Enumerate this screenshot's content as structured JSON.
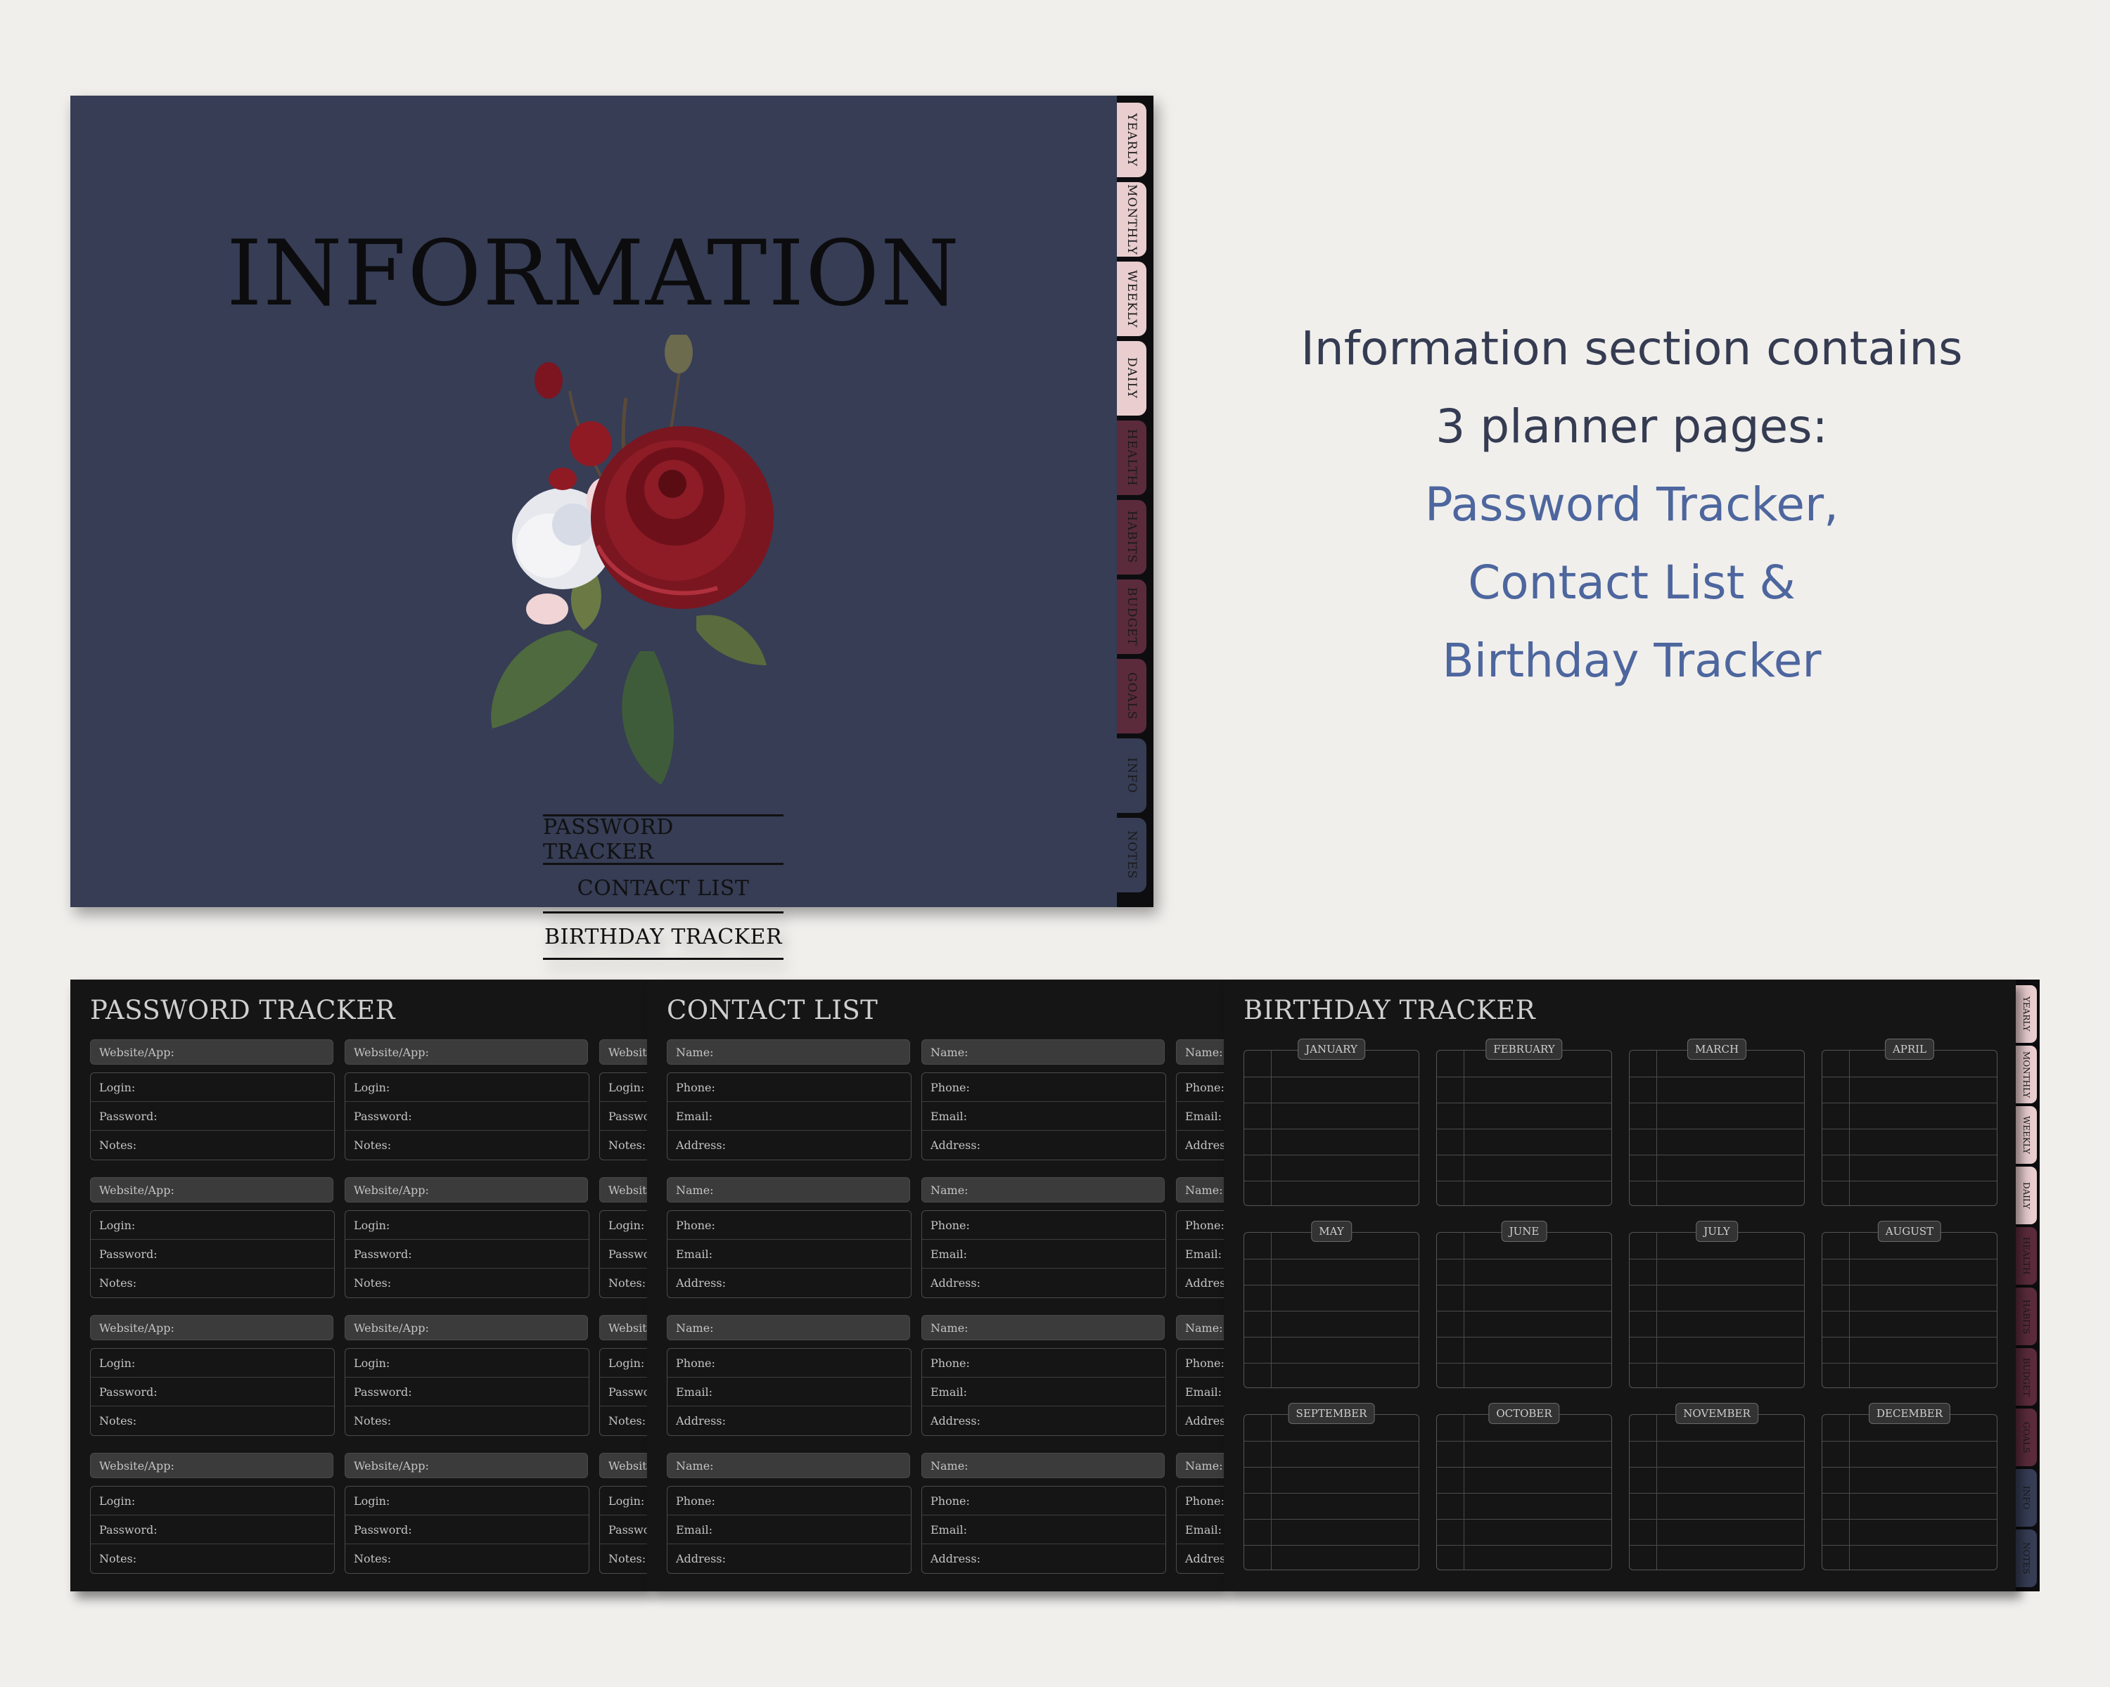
{
  "cover": {
    "title": "INFORMATION",
    "links": [
      "PASSWORD TRACKER",
      "CONTACT LIST",
      "BIRTHDAY TRACKER"
    ],
    "tabs": [
      {
        "label": "YEARLY",
        "color": "#e9cdcf"
      },
      {
        "label": "MONTHLY",
        "color": "#e9cdcf"
      },
      {
        "label": "WEEKLY",
        "color": "#e9cdcf"
      },
      {
        "label": "DAILY",
        "color": "#e9cdcf"
      },
      {
        "label": "HEALTH",
        "color": "#5b2b3b"
      },
      {
        "label": "HABITS",
        "color": "#5b2b3b"
      },
      {
        "label": "BUDGET",
        "color": "#5b2b3b"
      },
      {
        "label": "GOALS",
        "color": "#5b2b3b"
      },
      {
        "label": "INFO",
        "color": "#363d55"
      },
      {
        "label": "NOTES",
        "color": "#363d55"
      }
    ]
  },
  "caption": {
    "line1": "Information section contains",
    "line2": "3 planner pages:",
    "line3": "Password Tracker,",
    "line4": "Contact List &",
    "line5": "Birthday Tracker"
  },
  "password_tracker": {
    "title": "PASSWORD TRACKER",
    "head_label": "Website/App:",
    "row_labels": [
      "Login:",
      "Password:",
      "Notes:"
    ]
  },
  "contact_list": {
    "title": "CONTACT LIST",
    "head_label": "Name:",
    "row_labels": [
      "Phone:",
      "Email:",
      "Address:"
    ]
  },
  "birthday_tracker": {
    "title": "BIRTHDAY TRACKER",
    "months": [
      "JANUARY",
      "FEBRUARY",
      "MARCH",
      "APRIL",
      "MAY",
      "JUNE",
      "JULY",
      "AUGUST",
      "SEPTEMBER",
      "OCTOBER",
      "NOVEMBER",
      "DECEMBER"
    ]
  },
  "colors": {
    "cover_bg": "#363d55",
    "page_dark": "#151515",
    "caption_dark": "#353c52",
    "caption_blue": "#4d669e"
  }
}
